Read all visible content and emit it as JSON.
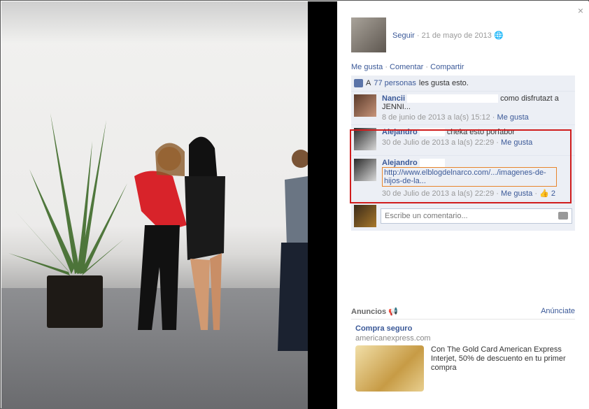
{
  "close_label": "×",
  "post": {
    "follow_label": "Seguir",
    "date": "21 de mayo de 2013"
  },
  "actions": {
    "like": "Me gusta",
    "comment": "Comentar",
    "share": "Compartir"
  },
  "likes": {
    "prefix": "A",
    "count_link": "77 personas",
    "suffix": "les gusta esto."
  },
  "comments": [
    {
      "author": "Nancii",
      "text": "como disfrutazt a JENNI...",
      "time": "8 de junio de 2013 a la(s) 15:12",
      "like": "Me gusta"
    },
    {
      "author": "Alejandro",
      "text": "cheka esto porfabor",
      "time": "30 de Julio de 2013 a la(s) 22:29",
      "like": "Me gusta"
    },
    {
      "author": "Alejandro",
      "link": "http://www.elblogdelnarco.com/.../imagenes-de-hijos-de-la...",
      "time": "30 de Julio de 2013 a la(s) 22:29",
      "like": "Me gusta",
      "like_count": "2"
    }
  ],
  "compose": {
    "placeholder": "Escribe un comentario..."
  },
  "ads": {
    "header": "Anuncios",
    "create": "Anúnciate",
    "title": "Compra seguro",
    "domain": "americanexpress.com",
    "body": "Con The Gold Card American Express Interjet, 50% de descuento en tu primer compra"
  }
}
